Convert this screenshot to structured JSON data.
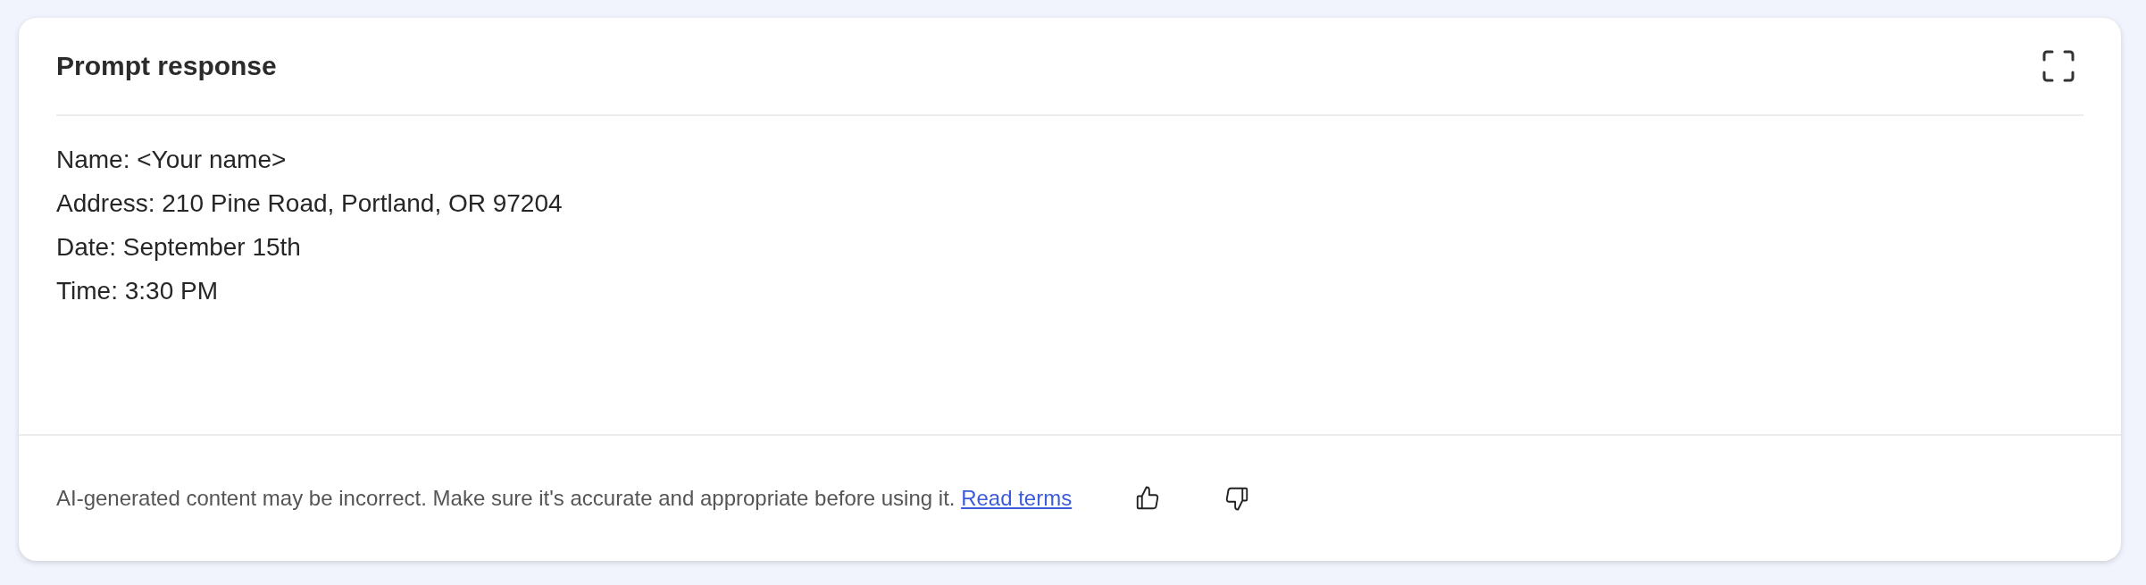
{
  "card": {
    "title": "Prompt response",
    "lines": [
      "Name: <Your name>",
      "Address: 210 Pine Road, Portland, OR 97204",
      "Date: September 15th",
      "Time: 3:30 PM"
    ],
    "footer": {
      "disclaimer": "AI-generated content may be incorrect. Make sure it's accurate and appropriate before using it.",
      "link": "Read terms"
    }
  }
}
